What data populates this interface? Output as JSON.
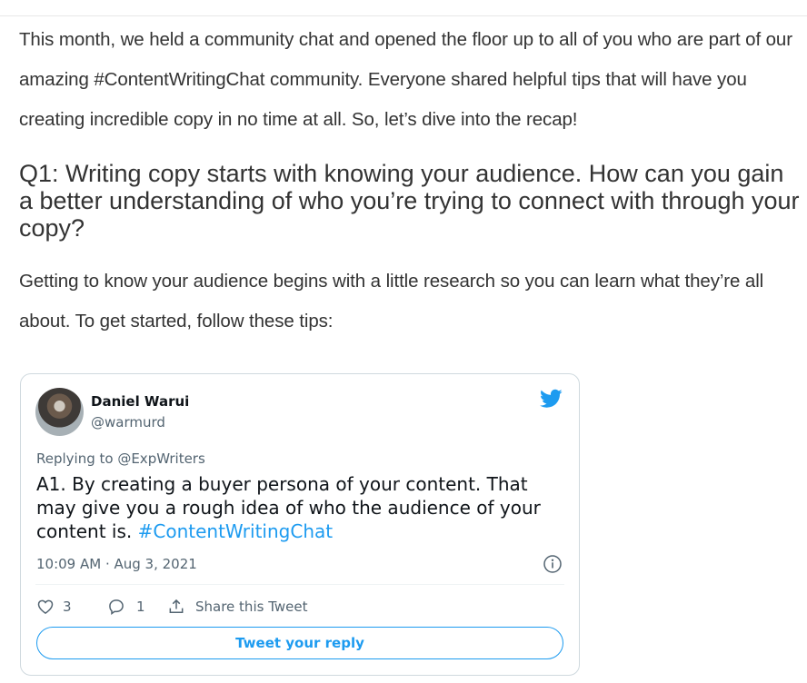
{
  "article": {
    "intro": "This month, we held a community chat and opened the floor up to all of you who are part of our amazing #ContentWritingChat community. Everyone shared helpful tips that will have you creating incredible copy in no time at all. So, let’s dive into the recap!",
    "heading": "Q1: Writing copy starts with knowing your audience. How can you gain a better understanding of who you’re trying to connect with through your copy?",
    "tips_intro": "Getting to know your audience begins with a little research so you can learn what they’re all about. To get started, follow these tips:"
  },
  "tweet": {
    "author_name": "Daniel Warui",
    "author_handle": "@warmurd",
    "replying_to": "Replying to @ExpWriters",
    "text": "A1. By creating a buyer persona of your content. That may give you a rough idea of who the audience of your content is. ",
    "hashtag": "#ContentWritingChat",
    "timestamp": "10:09 AM · Aug 3, 2021",
    "like_count": "3",
    "reply_count": "1",
    "share_label": "Share this Tweet",
    "reply_button": "Tweet your reply",
    "icons": {
      "brand": "twitter-bird-icon",
      "info": "info-icon",
      "like": "heart-icon",
      "reply": "speech-bubble-icon",
      "share": "share-icon"
    },
    "colors": {
      "accent": "#1d9bf0",
      "text": "#0f1419",
      "muted": "#536471"
    }
  }
}
